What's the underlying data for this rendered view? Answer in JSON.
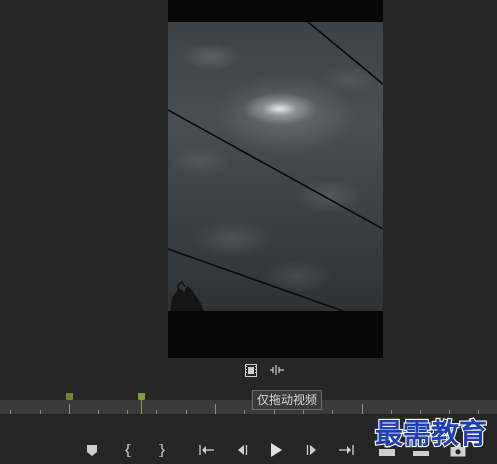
{
  "tooltip": {
    "text": "仅拖动视频"
  },
  "view_controls": {
    "filmstrip": {
      "icon": "filmstrip-icon"
    },
    "audio": {
      "icon": "audio-waveform-icon"
    }
  },
  "timeline": {
    "in_marker_color": "#6f8a2e",
    "playhead_color": "#7fa031"
  },
  "transport": {
    "buttons": [
      {
        "name": "add-marker-button",
        "icon": "marker-icon"
      },
      {
        "name": "mark-in-button",
        "icon": "mark-in-icon"
      },
      {
        "name": "mark-out-button",
        "icon": "mark-out-icon"
      },
      {
        "name": "go-to-in-button",
        "icon": "go-to-in-icon"
      },
      {
        "name": "step-back-button",
        "icon": "step-back-icon"
      },
      {
        "name": "play-button",
        "icon": "play-icon"
      },
      {
        "name": "step-forward-button",
        "icon": "step-forward-icon"
      },
      {
        "name": "go-to-out-button",
        "icon": "go-to-out-icon"
      },
      {
        "name": "insert-button",
        "icon": "insert-icon"
      },
      {
        "name": "overwrite-button",
        "icon": "overwrite-icon"
      },
      {
        "name": "export-frame-button",
        "icon": "camera-icon"
      }
    ]
  },
  "watermark": {
    "text": "最需教育",
    "color": "#1f3fb8"
  }
}
